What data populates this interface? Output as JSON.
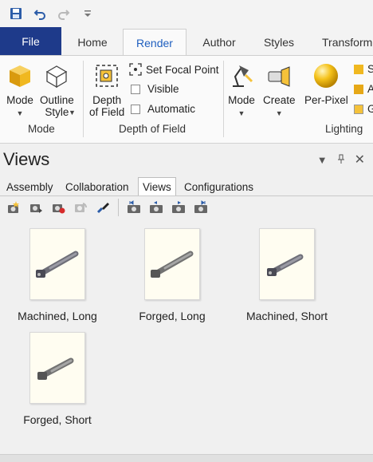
{
  "quick_access": {
    "icons": [
      "save-icon",
      "undo-icon",
      "redo-icon",
      "customize-dropdown-icon"
    ]
  },
  "tabs": [
    {
      "label": "File"
    },
    {
      "label": "Home"
    },
    {
      "label": "Render"
    },
    {
      "label": "Author"
    },
    {
      "label": "Styles"
    },
    {
      "label": "Transform"
    }
  ],
  "ribbon": {
    "mode_group": {
      "label": "Mode",
      "mode_btn": "Mode",
      "outline_style_btn_line1": "Outline",
      "outline_style_btn_line2": "Style"
    },
    "dof_group": {
      "label": "Depth of Field",
      "dof_btn_line1": "Depth",
      "dof_btn_line2": "of Field",
      "set_focal_point": "Set Focal Point",
      "visible": "Visible",
      "automatic": "Automatic"
    },
    "lighting_group": {
      "label": "Lighting",
      "mode_btn": "Mode",
      "create_btn": "Create",
      "per_pixel_btn": "Per-Pixel",
      "cut_items": [
        "S",
        "A",
        "G"
      ]
    }
  },
  "views_panel": {
    "title": "Views",
    "tabs": [
      {
        "label": "Assembly"
      },
      {
        "label": "Collaboration"
      },
      {
        "label": "Views"
      },
      {
        "label": "Configurations"
      }
    ],
    "toolbar_icons": [
      "new-view-icon",
      "update-view-icon",
      "record-view-icon",
      "refresh-view-icon",
      "paint-view-icon",
      "first-view-icon",
      "previous-view-icon",
      "next-view-icon",
      "last-view-icon"
    ],
    "views": [
      {
        "label": "Machined, Long"
      },
      {
        "label": "Forged, Long"
      },
      {
        "label": "Machined, Short"
      },
      {
        "label": "Forged, Short"
      }
    ]
  },
  "colors": {
    "file_tab": "#1e3a8a",
    "active_tab_text": "#1f5fbf",
    "thumb_bg": "#fffdf1"
  }
}
